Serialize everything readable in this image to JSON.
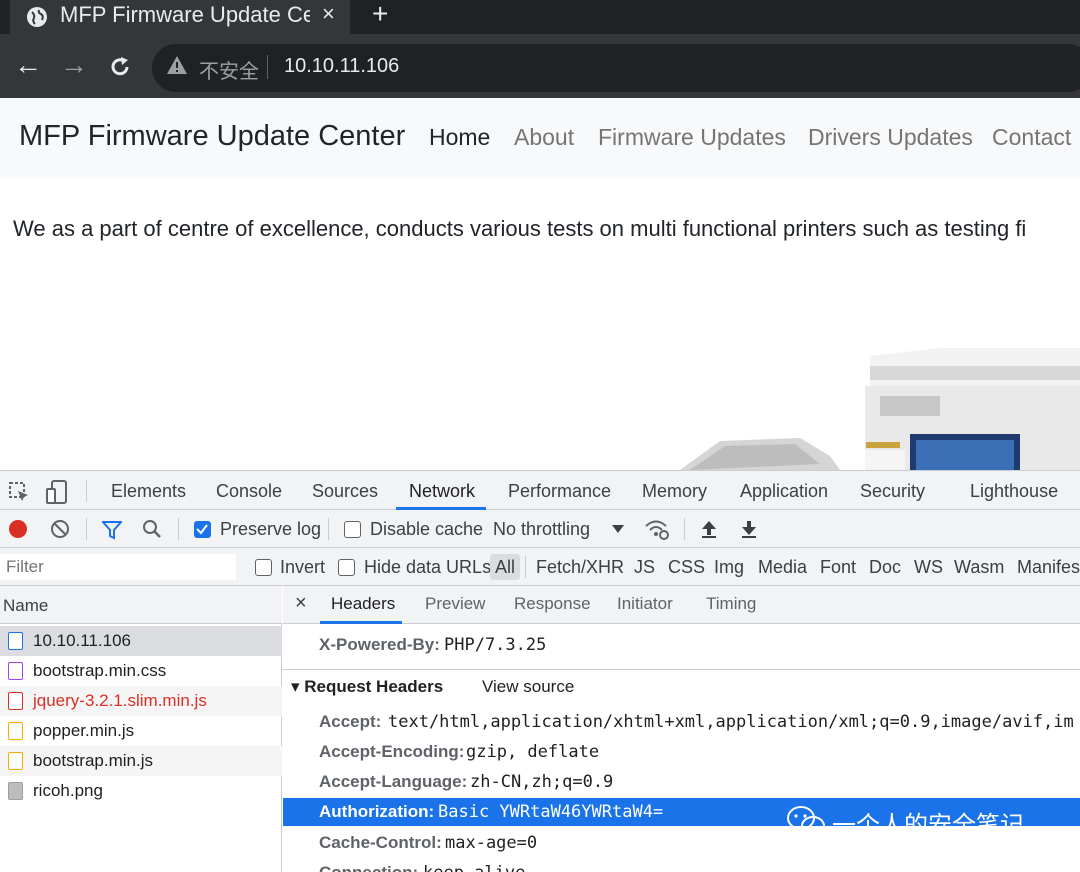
{
  "browser": {
    "tab_title": "MFP Firmware Update Ce",
    "tab_close": "×",
    "new_tab": "+",
    "back": "←",
    "forward": "→",
    "reload": "C",
    "security_label": "不安全",
    "url": "10.10.11.106"
  },
  "page": {
    "brand": "MFP Firmware Update Center",
    "nav": [
      "Home",
      "About",
      "Firmware Updates",
      "Drivers Updates",
      "Contact"
    ],
    "intro": "We as a part of centre of excellence, conducts various tests on multi functional printers such as testing fi"
  },
  "devtools": {
    "tabs": [
      "Elements",
      "Console",
      "Sources",
      "Network",
      "Performance",
      "Memory",
      "Application",
      "Security",
      "Lighthouse"
    ],
    "active_tab": "Network",
    "toolbar": {
      "preserve_log": "Preserve log",
      "preserve_log_checked": true,
      "disable_cache": "Disable cache",
      "disable_cache_checked": false,
      "throttling": "No throttling"
    },
    "filter": {
      "placeholder": "Filter",
      "invert": "Invert",
      "hide_data_urls": "Hide data URLs",
      "types": [
        "All",
        "Fetch/XHR",
        "JS",
        "CSS",
        "Img",
        "Media",
        "Font",
        "Doc",
        "WS",
        "Wasm",
        "Manifest"
      ]
    },
    "name_header": "Name",
    "requests": [
      {
        "name": "10.10.11.106",
        "kind": "doc",
        "color": "#202124"
      },
      {
        "name": "bootstrap.min.css",
        "kind": "css",
        "color": "#202124"
      },
      {
        "name": "jquery-3.2.1.slim.min.js",
        "kind": "js-error",
        "color": "#d93025"
      },
      {
        "name": "popper.min.js",
        "kind": "js",
        "color": "#202124"
      },
      {
        "name": "bootstrap.min.js",
        "kind": "js",
        "color": "#202124"
      },
      {
        "name": "ricoh.png",
        "kind": "img",
        "color": "#202124"
      }
    ],
    "detail_close": "×",
    "detail_tabs": [
      "Headers",
      "Preview",
      "Response",
      "Initiator",
      "Timing"
    ],
    "response_header": {
      "key": "X-Powered-By:",
      "value": "PHP/7.3.25"
    },
    "request_headers_title": "▾ Request Headers",
    "view_source": "View source",
    "request_headers": [
      {
        "key": "Accept:",
        "value": "text/html,application/xhtml+xml,application/xml;q=0.9,image/avif,im"
      },
      {
        "key": "Accept-Encoding:",
        "value": "gzip, deflate"
      },
      {
        "key": "Accept-Language:",
        "value": "zh-CN,zh;q=0.9"
      },
      {
        "key": "Authorization:",
        "value": "Basic YWRtaW46YWRtaW4="
      },
      {
        "key": "Cache-Control:",
        "value": "max-age=0"
      },
      {
        "key": "Connection:",
        "value": "keep-alive"
      }
    ]
  },
  "watermark": "一个人的安全笔记",
  "colors": {
    "accent": "#1a73e8",
    "error": "#d93025",
    "chrome_dark": "#202124"
  }
}
